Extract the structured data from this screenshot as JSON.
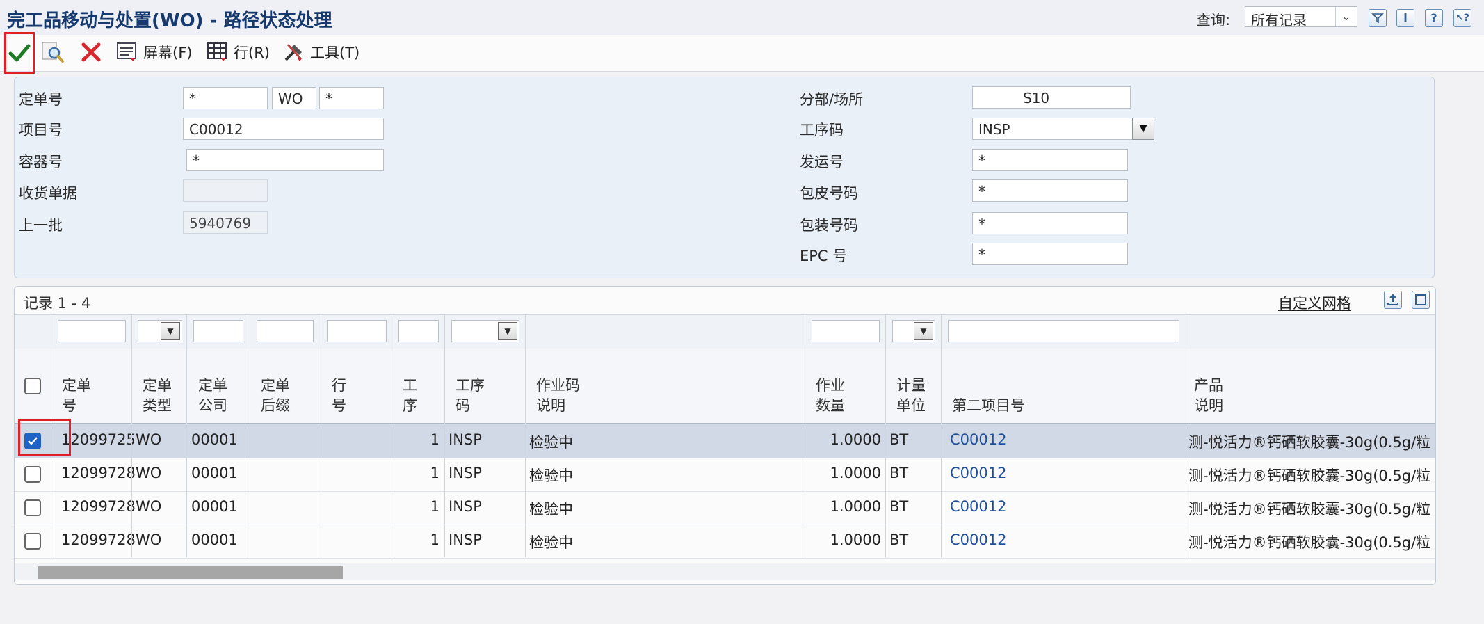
{
  "header": {
    "title": "完工品移动与处置(WO) - 路径状态处理",
    "query_label": "查询:",
    "query_value": "所有记录",
    "icons": [
      "filter-icon",
      "info-icon",
      "help-icon",
      "context-help-icon"
    ]
  },
  "toolbar": {
    "ok_icon": "checkmark-icon",
    "find_icon": "search-icon",
    "cancel_icon": "close-icon",
    "screen_label": "屏幕(F)",
    "row_label": "行(R)",
    "tools_label": "工具(T)"
  },
  "form": {
    "order_no": {
      "label": "定单号",
      "value1": "*",
      "value2": "WO",
      "value3": "*"
    },
    "item_no": {
      "label": "项目号",
      "value": "C00012"
    },
    "container_no": {
      "label": "容器号",
      "value": "*"
    },
    "receipt_doc": {
      "label": "收货单据",
      "value": ""
    },
    "last_lot": {
      "label": "上一批",
      "value": "5940769"
    },
    "branch_plant": {
      "label": "分部/场所",
      "value": "S10"
    },
    "operation_code": {
      "label": "工序码",
      "value": "INSP"
    },
    "shipment_no": {
      "label": "发运号",
      "value": "*"
    },
    "tare_no": {
      "label": "包皮号码",
      "value": "*"
    },
    "package_no": {
      "label": "包装号码",
      "value": "*"
    },
    "epc_no": {
      "label": "EPC 号",
      "value": "*"
    }
  },
  "grid": {
    "records_label": "记录 1 - 4",
    "custom_grid_label": "自定义网格",
    "columns": [
      {
        "l1": "定单",
        "l2": "号"
      },
      {
        "l1": "定单",
        "l2": "类型"
      },
      {
        "l1": "定单",
        "l2": "公司"
      },
      {
        "l1": "定单",
        "l2": "后缀"
      },
      {
        "l1": "行",
        "l2": "号"
      },
      {
        "l1": "工",
        "l2": "序"
      },
      {
        "l1": "工序",
        "l2": "码"
      },
      {
        "l1": "作业码",
        "l2": "说明"
      },
      {
        "l1": "作业",
        "l2": "数量"
      },
      {
        "l1": "计量",
        "l2": "单位"
      },
      {
        "l1": "",
        "l2": "第二项目号"
      },
      {
        "l1": "产品",
        "l2": "说明"
      }
    ],
    "rows": [
      {
        "checked": true,
        "order_no": "12099725",
        "type": "WO",
        "company": "00001",
        "suffix": "",
        "line": "",
        "seq": "1",
        "op": "INSP",
        "desc": "检验中",
        "qty": "1.0000",
        "uom": "BT",
        "item2": "C00012",
        "product": "测-悦活力®钙硒软胶囊-30g(0.5g/粒"
      },
      {
        "checked": false,
        "order_no": "12099728",
        "type": "WO",
        "company": "00001",
        "suffix": "",
        "line": "",
        "seq": "1",
        "op": "INSP",
        "desc": "检验中",
        "qty": "1.0000",
        "uom": "BT",
        "item2": "C00012",
        "product": "测-悦活力®钙硒软胶囊-30g(0.5g/粒"
      },
      {
        "checked": false,
        "order_no": "12099728",
        "type": "WO",
        "company": "00001",
        "suffix": "",
        "line": "",
        "seq": "1",
        "op": "INSP",
        "desc": "检验中",
        "qty": "1.0000",
        "uom": "BT",
        "item2": "C00012",
        "product": "测-悦活力®钙硒软胶囊-30g(0.5g/粒"
      },
      {
        "checked": false,
        "order_no": "12099728",
        "type": "WO",
        "company": "00001",
        "suffix": "",
        "line": "",
        "seq": "1",
        "op": "INSP",
        "desc": "检验中",
        "qty": "1.0000",
        "uom": "BT",
        "item2": "C00012",
        "product": "测-悦活力®钙硒软胶囊-30g(0.5g/粒"
      }
    ]
  },
  "colors": {
    "title": "#173a6e",
    "link": "#1f4f99",
    "highlight": "#e01f26",
    "selected_row": "#d2d9e6",
    "checkbox_on": "#1f63c6"
  }
}
